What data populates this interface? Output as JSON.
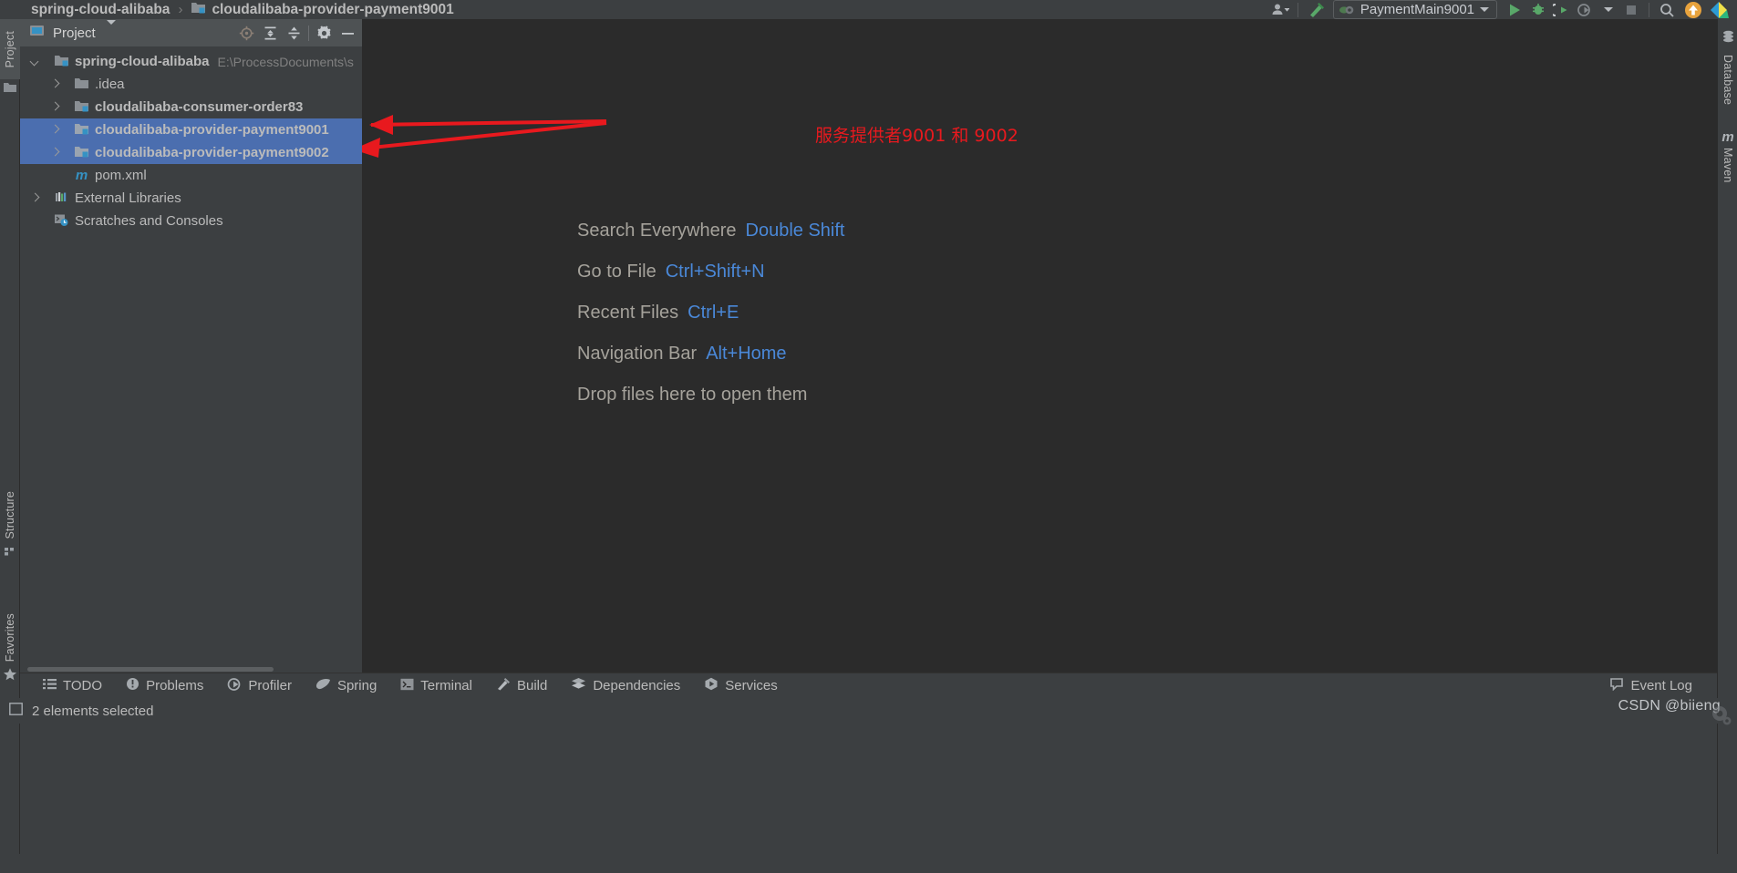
{
  "navbar": {
    "breadcrumbs": [
      {
        "label": "spring-cloud-alibaba",
        "icon": "none"
      },
      {
        "label": "cloudalibaba-provider-payment9001",
        "icon": "module-icon"
      }
    ],
    "separator": "›",
    "run_config": {
      "label": "PaymentMain9001",
      "icon": "run-config-icon"
    },
    "buttons": [
      {
        "name": "user-account-button",
        "icon": "person-icon"
      },
      {
        "name": "build-hammer-button",
        "icon": "hammer-icon"
      },
      {
        "name": "run-button",
        "icon": "play-icon"
      },
      {
        "name": "debug-button",
        "icon": "bug-icon"
      },
      {
        "name": "run-with-coverage-button",
        "icon": "coverage-icon"
      },
      {
        "name": "profile-button",
        "icon": "profiler-icon"
      },
      {
        "name": "stop-button",
        "icon": "stop-icon"
      },
      {
        "name": "search-button",
        "icon": "search-icon"
      },
      {
        "name": "update-project-button",
        "icon": "up-arrow-icon"
      },
      {
        "name": "ide-logo",
        "icon": "intellij-logo-icon"
      }
    ]
  },
  "left_strip": {
    "items": [
      {
        "label": "Project",
        "icon": "project-folder-icon",
        "active": true
      },
      {
        "label": "Structure",
        "icon": "structure-icon",
        "active": false
      },
      {
        "label": "Favorites",
        "icon": "star-icon",
        "active": false
      }
    ]
  },
  "right_strip": {
    "items": [
      {
        "label": "Database",
        "icon": "database-icon"
      },
      {
        "label": "Maven",
        "icon": "maven-m-icon"
      }
    ]
  },
  "project_panel": {
    "title": "Project",
    "dropdown_icon": "chevron-down-icon",
    "header_icons": [
      {
        "name": "locate-file-icon",
        "icon": "target-icon"
      },
      {
        "name": "expand-all-icon",
        "icon": "expand-icon"
      },
      {
        "name": "collapse-all-icon",
        "icon": "collapse-icon"
      },
      {
        "name": "panel-settings-icon",
        "icon": "gear-icon"
      },
      {
        "name": "hide-panel-icon",
        "icon": "minus-icon"
      }
    ],
    "tree": [
      {
        "label": "spring-cloud-alibaba",
        "path": "E:\\ProcessDocuments\\s",
        "icon": "module-icon",
        "state": "expanded",
        "indent": 0,
        "bold": true,
        "selected": false
      },
      {
        "label": ".idea",
        "path": "",
        "icon": "folder-icon",
        "state": "collapsed",
        "indent": 1,
        "bold": false,
        "selected": false
      },
      {
        "label": "cloudalibaba-consumer-order83",
        "path": "",
        "icon": "module-icon",
        "state": "collapsed",
        "indent": 1,
        "bold": true,
        "selected": false
      },
      {
        "label": "cloudalibaba-provider-payment9001",
        "path": "",
        "icon": "module-icon",
        "state": "collapsed",
        "indent": 1,
        "bold": true,
        "selected": true
      },
      {
        "label": "cloudalibaba-provider-payment9002",
        "path": "",
        "icon": "module-icon",
        "state": "collapsed",
        "indent": 1,
        "bold": true,
        "selected": true
      },
      {
        "label": "pom.xml",
        "path": "",
        "icon": "maven-pom-icon",
        "state": "leaf",
        "indent": 1,
        "bold": false,
        "selected": false
      },
      {
        "label": "External Libraries",
        "path": "",
        "icon": "libraries-icon",
        "state": "collapsed",
        "indent": 0,
        "bold": false,
        "selected": false
      },
      {
        "label": "Scratches and Consoles",
        "path": "",
        "icon": "scratches-icon",
        "state": "leaf",
        "indent": 0,
        "bold": false,
        "selected": false
      }
    ]
  },
  "editor": {
    "hints": [
      {
        "action": "Search Everywhere",
        "shortcut": "Double Shift"
      },
      {
        "action": "Go to File",
        "shortcut": "Ctrl+Shift+N"
      },
      {
        "action": "Recent Files",
        "shortcut": "Ctrl+E"
      },
      {
        "action": "Navigation Bar",
        "shortcut": "Alt+Home"
      },
      {
        "action": "Drop files here to open them",
        "shortcut": ""
      }
    ]
  },
  "annotation": {
    "text": "服务提供者9001 和 9002",
    "color": "#e8191e",
    "arrow_count": 2
  },
  "bottom_bar": {
    "items": [
      {
        "label": "TODO",
        "icon": "todo-list-icon"
      },
      {
        "label": "Problems",
        "icon": "problems-icon"
      },
      {
        "label": "Profiler",
        "icon": "profiler-icon"
      },
      {
        "label": "Spring",
        "icon": "spring-leaf-icon"
      },
      {
        "label": "Terminal",
        "icon": "terminal-icon"
      },
      {
        "label": "Build",
        "icon": "hammer-icon"
      },
      {
        "label": "Dependencies",
        "icon": "layers-icon"
      },
      {
        "label": "Services",
        "icon": "services-icon"
      }
    ],
    "event_log": {
      "label": "Event Log",
      "icon": "balloon-icon"
    }
  },
  "status_bar": {
    "text": "2 elements selected",
    "icon": "selection-icon",
    "watermark": "CSDN @biieng"
  },
  "colors": {
    "selection_blue": "#4b6eaf",
    "accent_blue": "#4a88d8",
    "panel_bg": "#3c3f41",
    "editor_bg": "#2b2b2b",
    "header_bg": "#4e5254",
    "annotation_red": "#e8191e"
  }
}
